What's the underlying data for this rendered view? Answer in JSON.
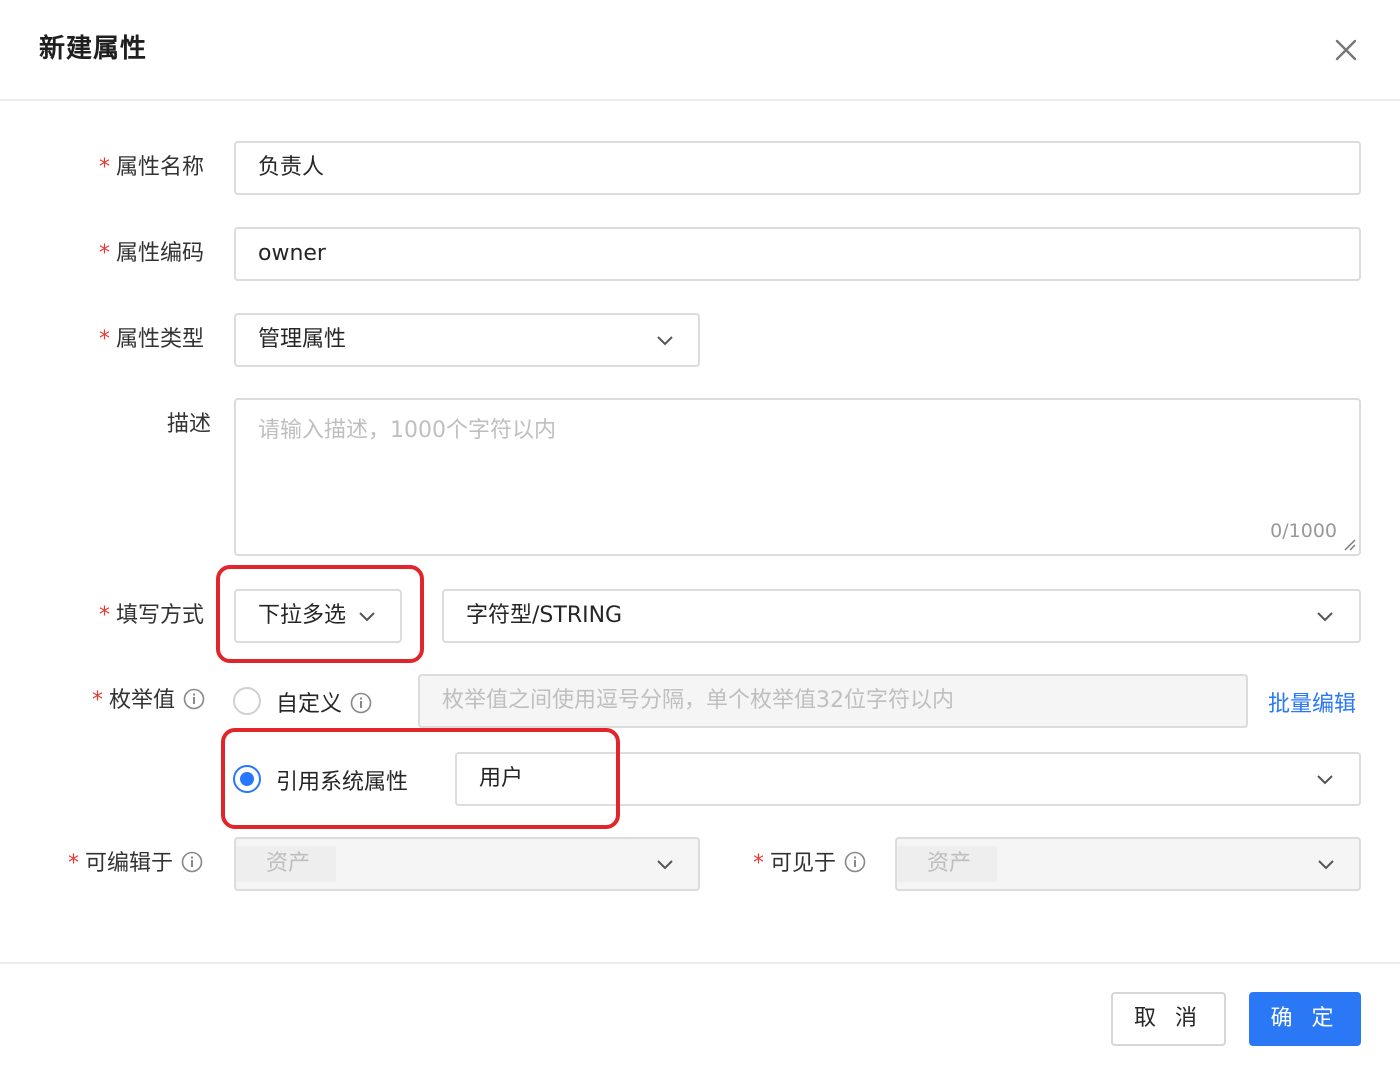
{
  "dialog": {
    "title": "新建属性",
    "close_icon": "close-icon"
  },
  "form": {
    "required_mark": "*",
    "name": {
      "label": "属性名称",
      "value": "负责人"
    },
    "code": {
      "label": "属性编码",
      "value": "owner"
    },
    "type": {
      "label": "属性类型",
      "value": "管理属性"
    },
    "description": {
      "label": "描述",
      "placeholder": "请输入描述，1000个字符以内",
      "count": "0/1000"
    },
    "fill_mode": {
      "label": "填写方式",
      "mode": "下拉多选",
      "data_type": "字符型/STRING"
    },
    "enum": {
      "label": "枚举值",
      "custom_label": "自定义",
      "custom_placeholder": "枚举值之间使用逗号分隔，单个枚举值32位字符以内",
      "batch_edit": "批量编辑",
      "system_label": "引用系统属性",
      "system_value": "用户",
      "selected": "system"
    },
    "editable_in": {
      "label": "可编辑于",
      "tag": "资产"
    },
    "visible_in": {
      "label": "可见于",
      "tag": "资产"
    }
  },
  "footer": {
    "cancel": "取 消",
    "ok": "确 定"
  },
  "colors": {
    "primary": "#2a78f5",
    "required": "#e53935",
    "highlight": "#e0262a"
  }
}
